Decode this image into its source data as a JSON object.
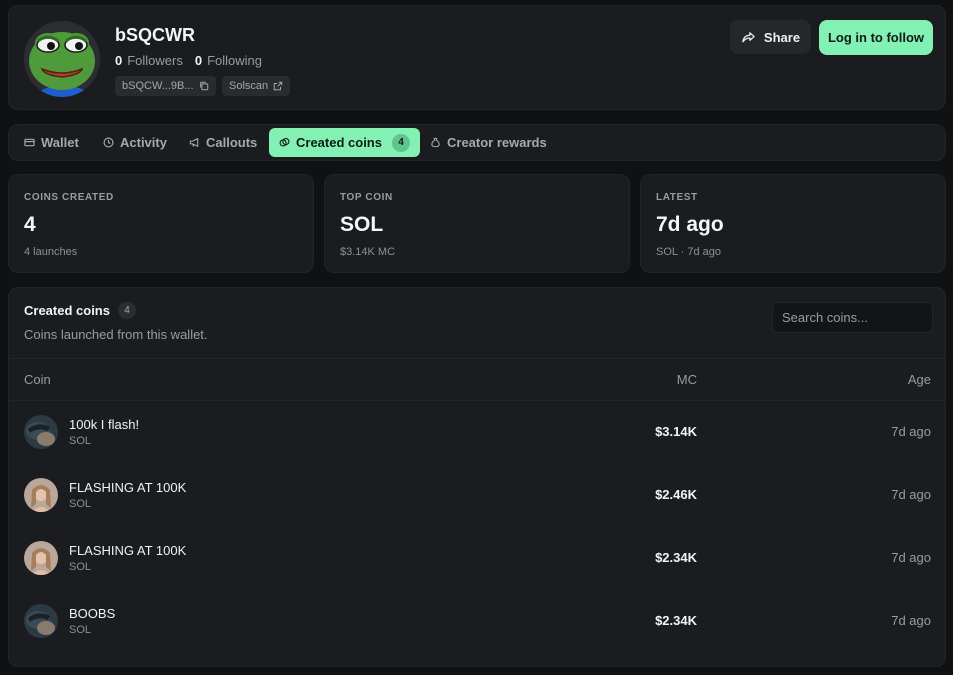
{
  "profile": {
    "username": "bSQCWR",
    "followers_count": "0",
    "followers_label": "Followers",
    "following_count": "0",
    "following_label": "Following",
    "address_chip": "bSQCW...9B...",
    "solscan_chip": "Solscan",
    "share_label": "Share",
    "follow_label": "Log in to follow"
  },
  "tabs": [
    {
      "label": "Wallet",
      "icon": "wallet-icon"
    },
    {
      "label": "Activity",
      "icon": "clock-icon"
    },
    {
      "label": "Callouts",
      "icon": "megaphone-icon"
    },
    {
      "label": "Created coins",
      "icon": "coins-icon",
      "badge": "4",
      "active": true
    },
    {
      "label": "Creator rewards",
      "icon": "moneybag-icon"
    }
  ],
  "cards": [
    {
      "label": "COINS CREATED",
      "value": "4",
      "sub": "4 launches"
    },
    {
      "label": "TOP COIN",
      "value": "SOL",
      "sub": "$3.14K MC"
    },
    {
      "label": "LATEST",
      "value": "7d ago",
      "sub": "SOL · 7d ago"
    }
  ],
  "coins": {
    "title": "Created coins",
    "count": "4",
    "description": "Coins launched from this wallet.",
    "search_placeholder": "Search coins...",
    "columns": {
      "coin": "Coin",
      "mc": "MC",
      "age": "Age"
    },
    "rows": [
      {
        "name": "100k I flash!",
        "ticker": "SOL",
        "mc": "$3.14K",
        "age": "7d ago"
      },
      {
        "name": "FLASHING AT 100K",
        "ticker": "SOL",
        "mc": "$2.46K",
        "age": "7d ago"
      },
      {
        "name": "FLASHING AT 100K",
        "ticker": "SOL",
        "mc": "$2.34K",
        "age": "7d ago"
      },
      {
        "name": "BOOBS",
        "ticker": "SOL",
        "mc": "$2.34K",
        "age": "7d ago"
      }
    ]
  },
  "colors": {
    "accent": "#83f0b4",
    "background": "#101113",
    "panel": "#1b1c1f"
  }
}
